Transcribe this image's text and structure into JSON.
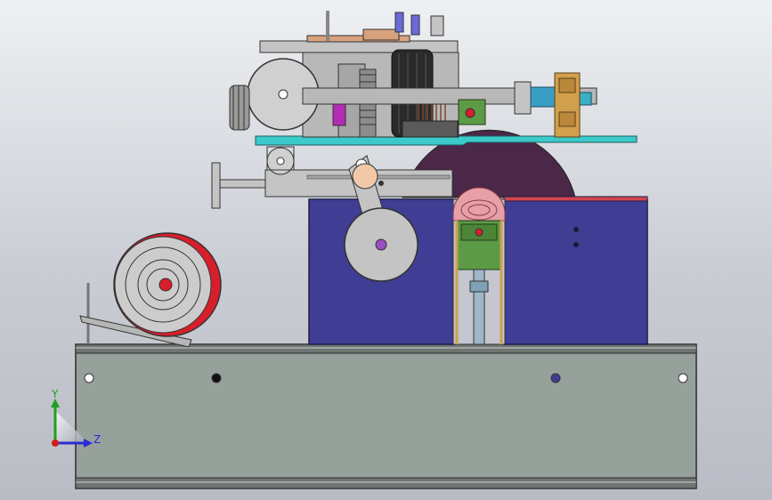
{
  "viewport": {
    "background_top": "#eef0f3",
    "background_bottom": "#b9bcc4"
  },
  "triad": {
    "y_label": "Y",
    "z_label": "Z",
    "y_color": "#1fa01f",
    "z_color": "#2b2bd6",
    "x_color": "#d41b1b"
  },
  "colors": {
    "base_rail": "#97a19c",
    "frame_blue": "#3f3e94",
    "disc_dark": "#4b2748",
    "teal_plate": "#3cc9c9",
    "reel_red": "#d61f2b",
    "green_block": "#5d9a46",
    "tan_bracket": "#d1a04c",
    "grey_metal": "#c4c4c4"
  }
}
